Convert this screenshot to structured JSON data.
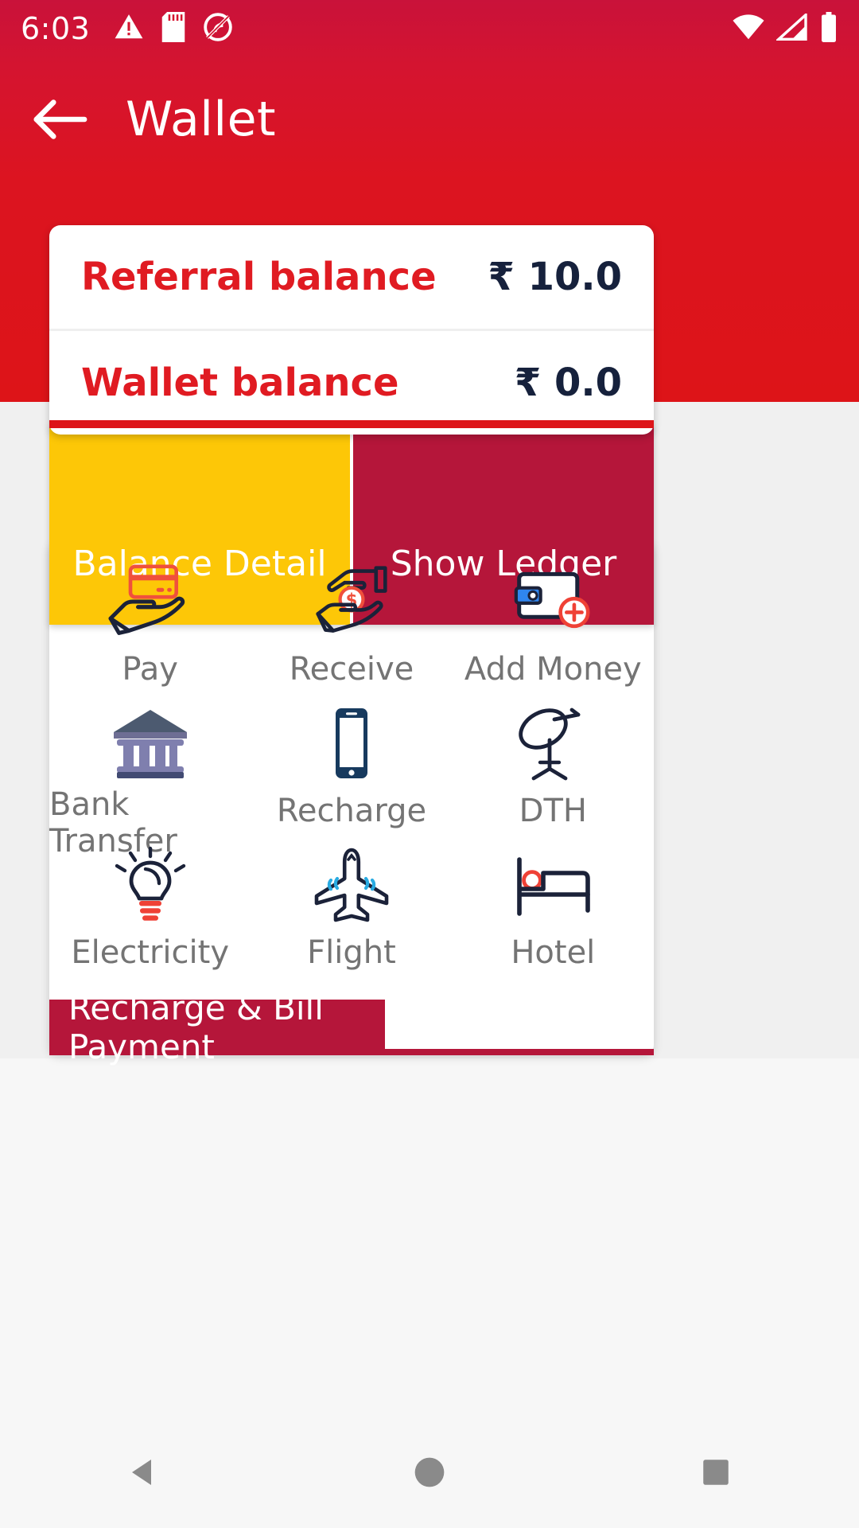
{
  "status_bar": {
    "time": "6:03",
    "left_icons": [
      "warning-triangle-icon",
      "sd-card-icon",
      "no-data-saver-icon"
    ],
    "right_icons": [
      "wifi-icon",
      "cellular-signal-icon",
      "battery-icon"
    ]
  },
  "app_bar": {
    "back_icon": "back-arrow-icon",
    "title": "Wallet"
  },
  "balance_card": {
    "rows": [
      {
        "label": "Referral balance",
        "amount": "₹ 10.0"
      },
      {
        "label": "Wallet balance",
        "amount": "₹ 0.0"
      }
    ]
  },
  "tabs": [
    {
      "label": "Balance Detail",
      "selected": true
    },
    {
      "label": "Show Ledger",
      "selected": false
    }
  ],
  "services": [
    {
      "label": "Pay",
      "icon": "hand-credit-card-icon"
    },
    {
      "label": "Receive",
      "icon": "hands-coin-icon"
    },
    {
      "label": "Add Money",
      "icon": "wallet-plus-icon"
    },
    {
      "label": "Bank Transfer",
      "icon": "bank-building-icon"
    },
    {
      "label": "Recharge",
      "icon": "mobile-phone-icon"
    },
    {
      "label": "DTH",
      "icon": "satellite-dish-icon"
    },
    {
      "label": "Electricity",
      "icon": "light-bulb-icon"
    },
    {
      "label": "Flight",
      "icon": "airplane-icon"
    },
    {
      "label": "Hotel",
      "icon": "bed-icon"
    }
  ],
  "banner": {
    "label": "Recharge & Bill Payment"
  },
  "nav_bar": {
    "back": "nav-back-triangle-icon",
    "home": "nav-home-circle-icon",
    "recents": "nav-recents-square-icon"
  },
  "colors": {
    "header_red": "#dd1418",
    "brand_red": "#e01b22",
    "tab_selected_yellow": "#fdc707",
    "tab_unselected_red": "#b5163a",
    "amount_navy": "#16213c",
    "label_gray": "#747474"
  }
}
